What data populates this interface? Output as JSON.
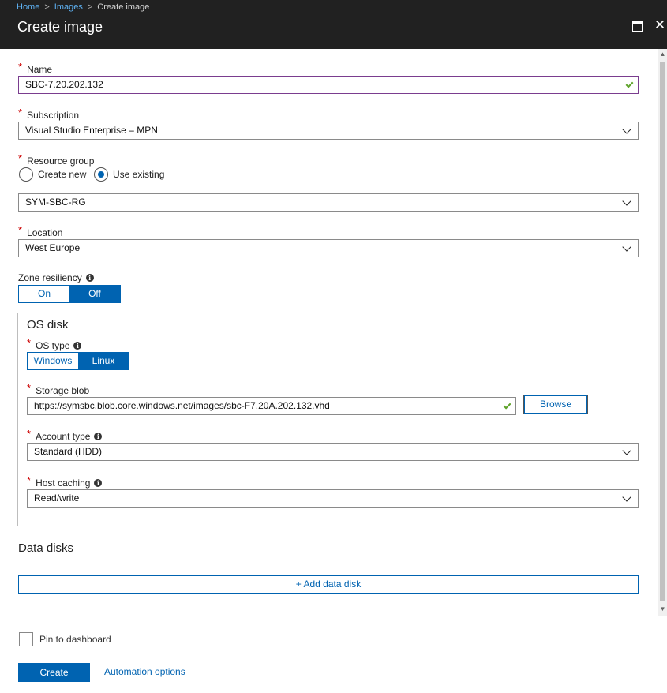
{
  "breadcrumb": {
    "home": "Home",
    "images": "Images",
    "current": "Create image",
    "separator": ">"
  },
  "header": {
    "title": "Create image"
  },
  "name": {
    "label": "Name",
    "value": "SBC-7.20.202.132"
  },
  "subscription": {
    "label": "Subscription",
    "value": "Visual Studio Enterprise – MPN"
  },
  "resource_group": {
    "label": "Resource group",
    "option_new": "Create new",
    "option_existing": "Use existing",
    "selected": "Use existing",
    "value": "SYM-SBC-RG"
  },
  "location": {
    "label": "Location",
    "value": "West Europe"
  },
  "zone_resiliency": {
    "label": "Zone resiliency",
    "on": "On",
    "off": "Off",
    "selected": "Off"
  },
  "os_disk": {
    "title": "OS disk",
    "os_type": {
      "label": "OS type",
      "windows": "Windows",
      "linux": "Linux",
      "selected": "Linux"
    },
    "storage_blob": {
      "label": "Storage blob",
      "value": "https://symsbc.blob.core.windows.net/images/sbc-F7.20A.202.132.vhd",
      "browse": "Browse"
    },
    "account_type": {
      "label": "Account type",
      "value": "Standard (HDD)"
    },
    "host_caching": {
      "label": "Host caching",
      "value": "Read/write"
    }
  },
  "data_disks": {
    "title": "Data disks",
    "add": "+ Add data disk"
  },
  "footer": {
    "pin": "Pin to dashboard",
    "create": "Create",
    "automation": "Automation options"
  },
  "icons": {
    "info": "i",
    "close": "✕",
    "scroll_up": "▲",
    "scroll_down": "▼"
  },
  "colors": {
    "accent": "#0063b1",
    "header_bg": "#212121",
    "required": "#c00000",
    "valid": "#5ea32a"
  }
}
